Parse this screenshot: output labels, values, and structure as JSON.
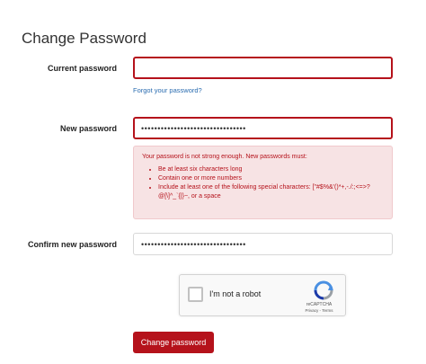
{
  "page_title": "Change Password",
  "current_password": {
    "label": "Current password",
    "value": ""
  },
  "forgot_link": "Forgot your password?",
  "new_password": {
    "label": "New password",
    "value": "••••••••••••••••••••••••••••••••"
  },
  "alert": {
    "intro": "Your password is not strong enough. New passwords must:",
    "rules": [
      "Be at least six characters long",
      "Contain one or more numbers",
      "Include at least one of the following special characters: [\"#$%&'()*+,-./:;<=>?@[\\]^_`{|}~, or a space"
    ]
  },
  "confirm_password": {
    "label": "Confirm new password",
    "value": "••••••••••••••••••••••••••••••••"
  },
  "captcha": {
    "label": "I'm not a robot",
    "brand": "reCAPTCHA",
    "links": "Privacy - Terms"
  },
  "submit_label": "Change password",
  "colors": {
    "accent": "#b5121b",
    "alert_bg": "#f7e3e4",
    "link": "#2a6cb0"
  }
}
